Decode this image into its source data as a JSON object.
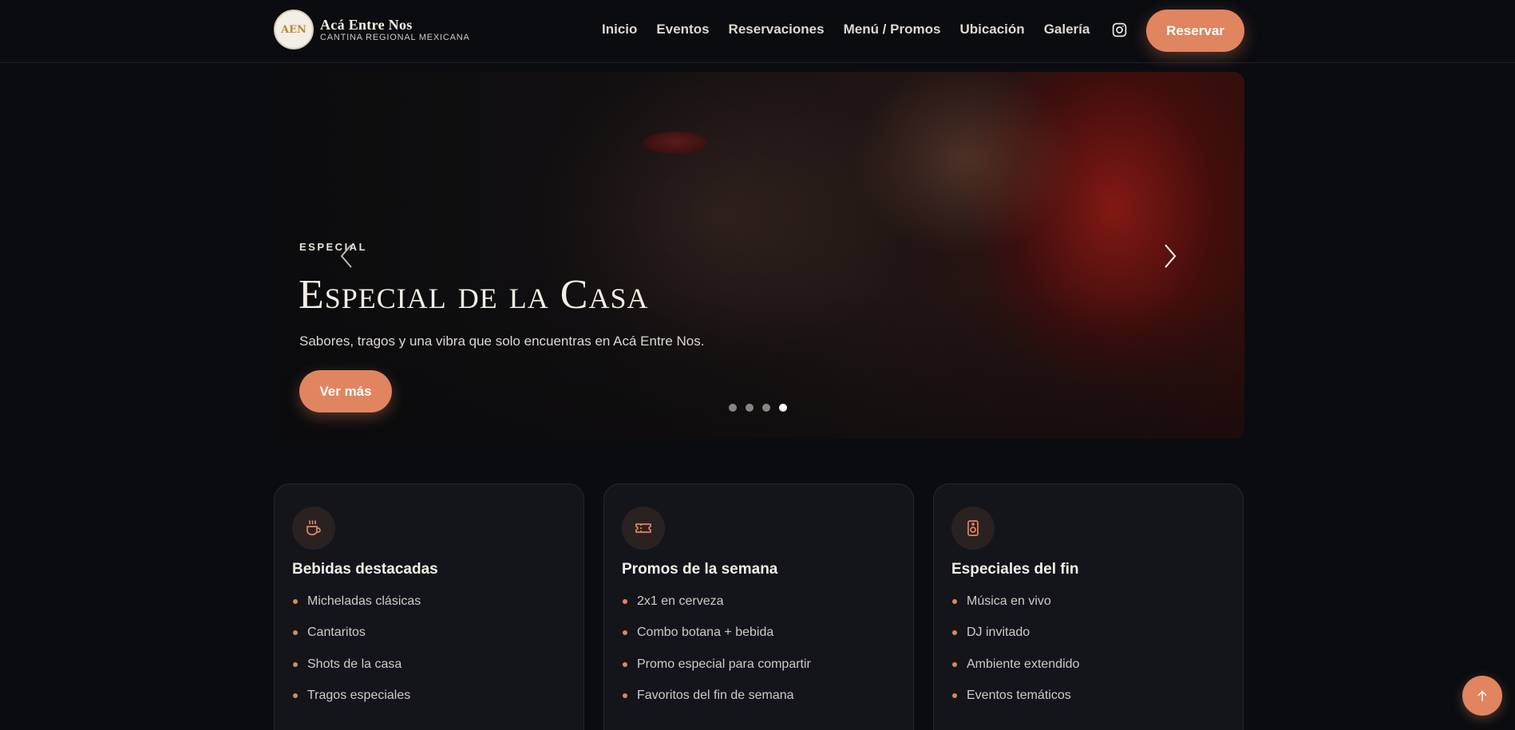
{
  "brand": {
    "logo_mark": "AEN",
    "name": "Acá Entre Nos",
    "subtitle": "CANTINA REGIONAL MEXICANA"
  },
  "nav": {
    "links": [
      "Inicio",
      "Eventos",
      "Reservaciones",
      "Menú / Promos",
      "Ubicación",
      "Galería"
    ],
    "instagram_icon": "instagram-icon",
    "reserve_label": "Reservar"
  },
  "hero": {
    "eyebrow": "ESPECIAL",
    "title": "Especial de la Casa",
    "subtitle": "Sabores, tragos y una vibra que solo encuentras en Acá Entre Nos.",
    "button_label": "Ver más",
    "slide_count": 4,
    "active_slide": 4
  },
  "cards": [
    {
      "icon": "cup-icon",
      "title": "Bebidas destacadas",
      "items": [
        "Micheladas clásicas",
        "Cantaritos",
        "Shots de la casa",
        "Tragos especiales"
      ]
    },
    {
      "icon": "ticket-icon",
      "title": "Promos de la semana",
      "items": [
        "2x1 en cerveza",
        "Combo botana + bebida",
        "Promo especial para compartir",
        "Favoritos del fin de semana"
      ]
    },
    {
      "icon": "speaker-icon",
      "title": "Especiales del fin",
      "items": [
        "Música en vivo",
        "DJ invitado",
        "Ambiente extendido",
        "Eventos temáticos"
      ]
    }
  ],
  "colors": {
    "accent": "#e0855f",
    "background": "#0b0c10",
    "card": "#14151b"
  }
}
